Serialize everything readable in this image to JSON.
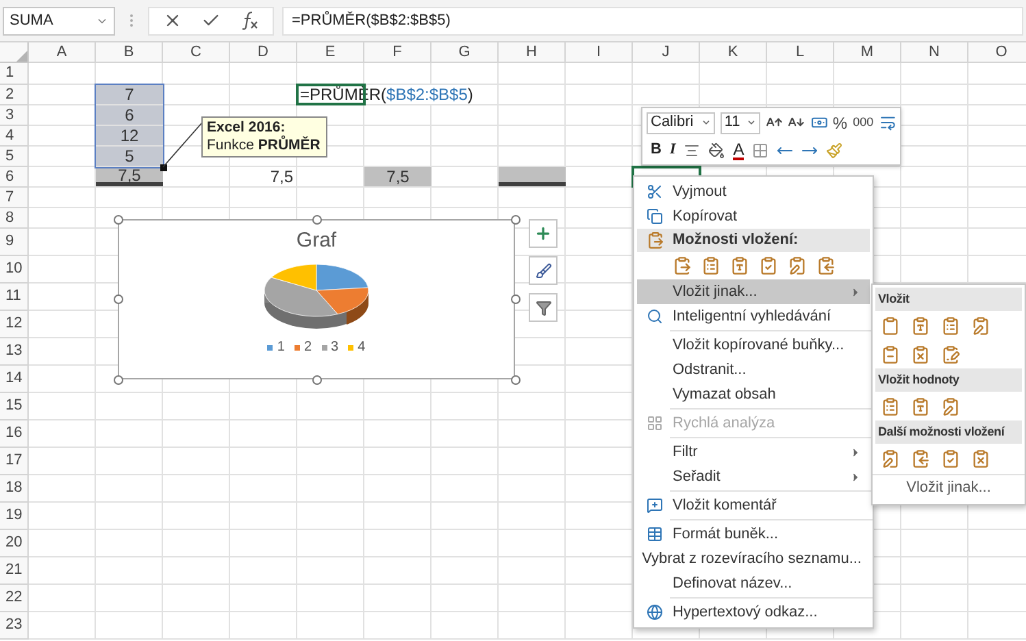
{
  "formula_bar": {
    "name_box": "SUMA",
    "formula": "=PRŮMĚR($B$2:$B$5)"
  },
  "columns": [
    "A",
    "B",
    "C",
    "D",
    "E",
    "F",
    "G",
    "H",
    "I",
    "J",
    "K",
    "L",
    "M",
    "N",
    "O"
  ],
  "rows": [
    {
      "header": "1"
    },
    {
      "header": "2",
      "cells": {
        "b": {
          "kind": "centered",
          "value": "7",
          "selected": true,
          "active": false,
          "shaded": false,
          "underlined": false
        },
        "e": {
          "kind": "formula",
          "formula": "=PRŮMĚR(",
          "reference": "$B$2:$B$5",
          "closing": ")",
          "active": true
        }
      }
    },
    {
      "header": "3",
      "cells": {
        "b": {
          "kind": "centered",
          "value": "6",
          "selected": true,
          "active": false,
          "shaded": false,
          "underlined": false
        }
      }
    },
    {
      "header": "4",
      "cells": {
        "b": {
          "kind": "centered",
          "value": "12",
          "selected": true,
          "active": false,
          "shaded": false,
          "underlined": false
        }
      }
    },
    {
      "header": "5",
      "cells": {
        "b": {
          "kind": "centered",
          "value": "5",
          "selected": true,
          "active": false,
          "shaded": false,
          "underlined": false
        }
      }
    },
    {
      "header": "6",
      "cells": {
        "b": {
          "kind": "centered",
          "value": "7,5",
          "active": false,
          "shaded": true,
          "underlined": true
        },
        "d": {
          "kind": "right-aligned",
          "value": "7,5",
          "selected": false,
          "active": false,
          "shaded": false,
          "underlined": false
        },
        "f": {
          "kind": "centered",
          "value": "7,5",
          "active": false,
          "shaded": true,
          "underlined": false
        },
        "h": {
          "kind": "empty",
          "active": false,
          "shaded": true,
          "underlined": true
        },
        "j": {
          "kind": "empty",
          "selected": false,
          "active": true,
          "shaded": false
        }
      }
    },
    {
      "header": "7"
    },
    {
      "header": "8"
    },
    {
      "header": "9"
    },
    {
      "header": "10"
    },
    {
      "header": "11"
    },
    {
      "header": "12"
    },
    {
      "header": "13"
    },
    {
      "header": "14"
    },
    {
      "header": "15"
    },
    {
      "header": "16"
    },
    {
      "header": "17"
    },
    {
      "header": "18"
    },
    {
      "header": "19"
    },
    {
      "header": "20"
    },
    {
      "header": "21"
    },
    {
      "header": "22"
    },
    {
      "header": "23"
    }
  ],
  "callout": {
    "title": "Excel 2016:",
    "text": "Funkce **PRŮMĚR**"
  },
  "chart": {
    "title": "Graf",
    "legend": [
      {
        "label": "1",
        "color": "#5b9bd5"
      },
      {
        "label": "2",
        "color": "#ed7d31"
      },
      {
        "label": "3",
        "color": "#a5a5a5"
      },
      {
        "label": "4",
        "color": "#ffc000"
      }
    ]
  },
  "mini_toolbar": {
    "font": "Calibri",
    "size": "11",
    "percent": "%",
    "thousands": "000",
    "bold": "B",
    "italic": "I",
    "font_color": "A"
  },
  "context_menu": {
    "items": [
      {
        "kind": "cut",
        "label": "Vyjmout",
        "selected": false,
        "disabled": false,
        "submenu": false
      },
      {
        "kind": "copy",
        "label": "Kopírovat",
        "selected": false,
        "disabled": false,
        "submenu": false
      },
      {
        "kind": "header",
        "label": "Možnosti vložení:"
      },
      {
        "kind": "paste-options"
      },
      {
        "kind": "command",
        "label": "Vložit jinak...",
        "selected": true,
        "disabled": false,
        "submenu": true
      },
      {
        "kind": "lookup",
        "label": "Inteligentní vyhledávání",
        "selected": false,
        "disabled": false,
        "submenu": false
      },
      {
        "kind": "separator"
      },
      {
        "kind": "command",
        "label": "Vložit kopírované buňky...",
        "selected": false,
        "disabled": false,
        "submenu": false
      },
      {
        "kind": "command",
        "label": "Odstranit...",
        "selected": false,
        "disabled": false,
        "submenu": false
      },
      {
        "kind": "command",
        "label": "Vymazat obsah",
        "selected": false,
        "disabled": false,
        "submenu": false
      },
      {
        "kind": "separator"
      },
      {
        "kind": "analysis",
        "label": "Rychlá analýza",
        "selected": false,
        "disabled": true,
        "submenu": false
      },
      {
        "kind": "separator"
      },
      {
        "kind": "command",
        "label": "Filtr",
        "selected": false,
        "disabled": false,
        "submenu": true
      },
      {
        "kind": "command",
        "label": "Seřadit",
        "selected": false,
        "disabled": false,
        "submenu": true
      },
      {
        "kind": "separator"
      },
      {
        "kind": "comment",
        "label": "Vložit komentář",
        "selected": false,
        "disabled": false,
        "submenu": false
      },
      {
        "kind": "separator"
      },
      {
        "kind": "format",
        "label": "Formát buněk...",
        "selected": false,
        "disabled": false,
        "submenu": false
      },
      {
        "kind": "command",
        "label": "Vybrat z rozevíracího seznamu...",
        "selected": false,
        "disabled": false,
        "submenu": false
      },
      {
        "kind": "command",
        "label": "Definovat název...",
        "selected": false,
        "disabled": false,
        "submenu": false
      },
      {
        "kind": "separator"
      },
      {
        "kind": "link",
        "label": "Hypertextový odkaz...",
        "selected": false,
        "disabled": false,
        "submenu": false
      }
    ]
  },
  "submenu": {
    "sections": [
      {
        "title": "Vložit"
      },
      {
        "title": "Vložit hodnoty"
      },
      {
        "title": "Další možnosti vložení"
      }
    ],
    "footer": "Vložit jinak..."
  }
}
